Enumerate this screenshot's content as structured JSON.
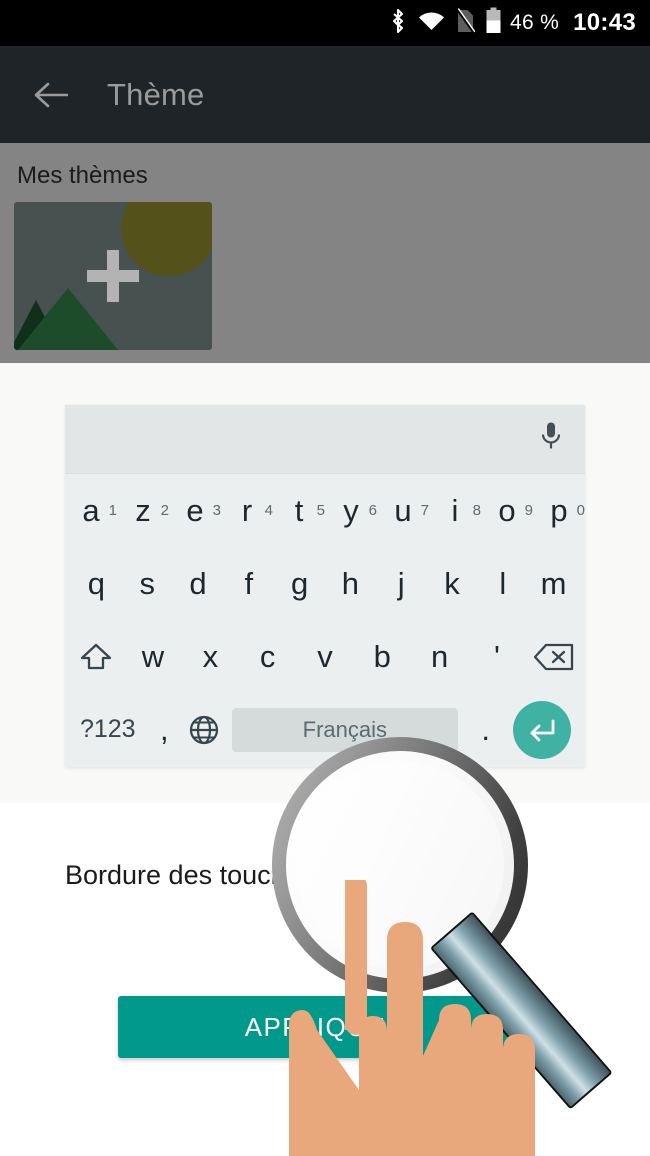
{
  "statusbar": {
    "battery_text": "46 %",
    "time": "10:43",
    "icons": [
      "bluetooth-icon",
      "wifi-icon",
      "sim-off-icon",
      "battery-icon"
    ]
  },
  "appbar": {
    "back_label": "back-arrow-icon",
    "title": "Thème"
  },
  "themes_section": {
    "label": "Mes thèmes",
    "card": {
      "name": "add-theme-card",
      "plus": "+",
      "colors": {
        "background": "#465150",
        "sun": "#55511a",
        "mountain_front": "#1c4c29",
        "mountain_back": "#10301c",
        "plus": "#b3b3b3"
      }
    },
    "overlay_color": "#848484"
  },
  "keyboard": {
    "mic_icon": "microphone-icon",
    "row1": [
      {
        "key": "a",
        "sup": "1"
      },
      {
        "key": "z",
        "sup": "2"
      },
      {
        "key": "e",
        "sup": "3"
      },
      {
        "key": "r",
        "sup": "4"
      },
      {
        "key": "t",
        "sup": "5"
      },
      {
        "key": "y",
        "sup": "6"
      },
      {
        "key": "u",
        "sup": "7"
      },
      {
        "key": "i",
        "sup": "8"
      },
      {
        "key": "o",
        "sup": "9"
      },
      {
        "key": "p",
        "sup": "0"
      }
    ],
    "row2": [
      "q",
      "s",
      "d",
      "f",
      "g",
      "h",
      "j",
      "k",
      "l",
      "m"
    ],
    "row3": [
      "w",
      "x",
      "c",
      "v",
      "b",
      "n",
      "'"
    ],
    "shift_icon": "shift-icon",
    "backspace_icon": "backspace-icon",
    "symbols_key": "?123",
    "comma_key": ",",
    "globe_icon": "globe-icon",
    "space_label": "Français",
    "period_key": ".",
    "enter_icon": "enter-icon",
    "colors": {
      "body": "#eceff0",
      "suggestion_strip": "#e3e6e7",
      "space": "#d5dadb",
      "enter": "#3fb2a4",
      "text": "#1d282e"
    }
  },
  "setting": {
    "label": "Bordure des touches",
    "toggle_state": "off",
    "toggle_track_color": "#bdbdbd",
    "toggle_knob_color": "#f1f1f1"
  },
  "apply_button": {
    "label": "APPLIQUER",
    "color": "#00998c"
  },
  "annotation": {
    "magnifier": "magnifier-icon",
    "hand": "pointing-hand-icon",
    "hand_color": "#e8a87c"
  }
}
